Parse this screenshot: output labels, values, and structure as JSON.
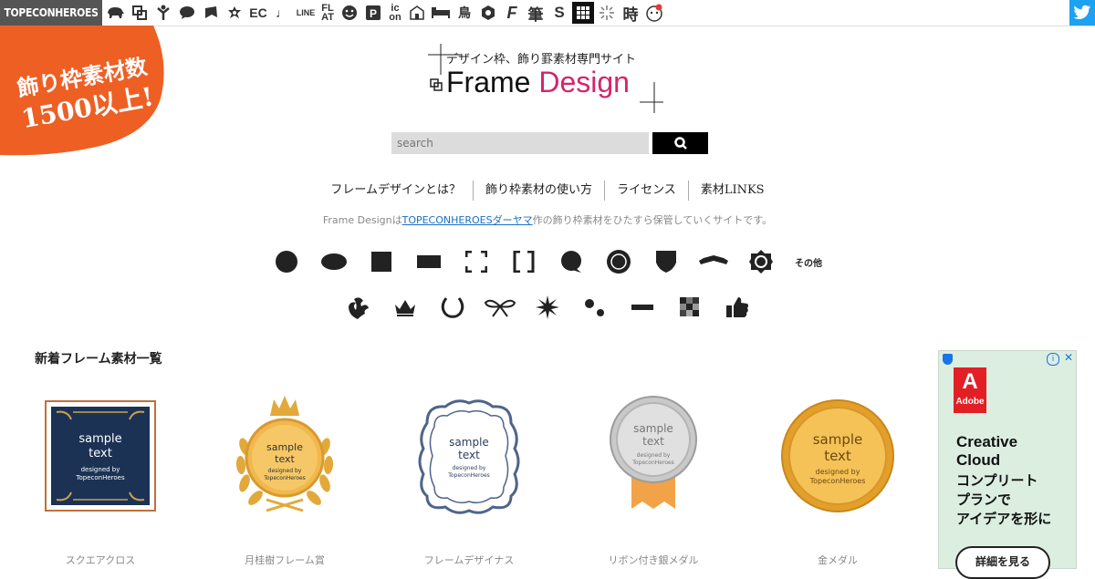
{
  "topbar": {
    "brand": "TOPECONHEROES",
    "icons": [
      {
        "name": "animal-icon",
        "glyph": "🐘"
      },
      {
        "name": "frame-icon",
        "glyph": "⧉"
      },
      {
        "name": "person-icon",
        "glyph": "Y"
      },
      {
        "name": "speech-bubble-icon",
        "glyph": "💬"
      },
      {
        "name": "cursor-icon",
        "glyph": "◣"
      },
      {
        "name": "flower-icon",
        "glyph": "✿"
      },
      {
        "name": "ec-text-icon",
        "glyph": "EC"
      },
      {
        "name": "music-note-icon",
        "glyph": "♩"
      },
      {
        "name": "line-text-icon",
        "glyph": "LINE"
      },
      {
        "name": "flat-text-icon",
        "glyph": "FL AT"
      },
      {
        "name": "smiley-icon",
        "glyph": "☻"
      },
      {
        "name": "parking-icon",
        "glyph": "P"
      },
      {
        "name": "icon-text-icon",
        "glyph": "ic on"
      },
      {
        "name": "building-icon",
        "glyph": "⌂"
      },
      {
        "name": "bed-icon",
        "glyph": "▬"
      },
      {
        "name": "bird-kanji-icon",
        "glyph": "鳥"
      },
      {
        "name": "octagon-icon",
        "glyph": "⬢"
      },
      {
        "name": "f-letter-icon",
        "glyph": "F"
      },
      {
        "name": "brush-kanji-icon",
        "glyph": "筆"
      },
      {
        "name": "s-letter-icon",
        "glyph": "S"
      },
      {
        "name": "grid-icon",
        "glyph": "▦"
      },
      {
        "name": "sparkle-icon",
        "glyph": "✳"
      },
      {
        "name": "time-kanji-icon",
        "glyph": "時"
      },
      {
        "name": "face-icon",
        "glyph": "☺"
      }
    ]
  },
  "badge": {
    "line1": "飾り枠素材数",
    "line2": "1500以上!"
  },
  "logo": {
    "subtitle": "デザイン枠、飾り罫素材専門サイト",
    "title_part1": "Frame",
    "title_part2": "Design",
    "accent": "#d4256c"
  },
  "search": {
    "placeholder": "search"
  },
  "nav": [
    {
      "label": "フレームデザインとは？"
    },
    {
      "label": "飾り枠素材の使い方"
    },
    {
      "label": "ライセンス"
    },
    {
      "label": "素材LINKS"
    }
  ],
  "tagline": {
    "before": "Frame Designは",
    "link": "TOPECONHEROESダーヤマ",
    "after": "作の飾り枠素材をひたすら保管していくサイトです。"
  },
  "categories_row1": [
    {
      "name": "circle-icon"
    },
    {
      "name": "oval-icon"
    },
    {
      "name": "square-icon"
    },
    {
      "name": "rectangle-icon"
    },
    {
      "name": "corner-brackets-icon"
    },
    {
      "name": "square-brackets-icon"
    },
    {
      "name": "speech-bubble-icon"
    },
    {
      "name": "stamp-seal-icon"
    },
    {
      "name": "shield-icon"
    },
    {
      "name": "ribbon-banner-icon"
    },
    {
      "name": "ornament-octagon-icon"
    },
    {
      "name": "other-text-icon",
      "text": "その他"
    }
  ],
  "categories_row2": [
    {
      "name": "floral-flourish-icon"
    },
    {
      "name": "crown-icon"
    },
    {
      "name": "laurel-wreath-icon"
    },
    {
      "name": "bow-knot-icon"
    },
    {
      "name": "starburst-icon"
    },
    {
      "name": "dots-icon"
    },
    {
      "name": "line-dash-icon"
    },
    {
      "name": "mosaic-icon"
    },
    {
      "name": "thumbs-up-icon"
    }
  ],
  "section": {
    "title": "新着フレーム素材一覧"
  },
  "frames": [
    {
      "label": "スクエアクロス",
      "t1": "sample",
      "t2": "text",
      "t3": "designed by",
      "t4": "TopeconHeroes"
    },
    {
      "label": "月桂樹フレーム賞",
      "t1": "sample",
      "t2": "text",
      "t3": "designed by",
      "t4": "TopeconHeroes"
    },
    {
      "label": "フレームデザイナス",
      "t1": "sample",
      "t2": "text",
      "t3": "designed by",
      "t4": "TopeconHeroes"
    },
    {
      "label": "リボン付き銀メダル",
      "t1": "sample",
      "t2": "text",
      "t3": "designed by",
      "t4": "TopeconHeroes"
    },
    {
      "label": "金メダル",
      "t1": "sample",
      "t2": "text",
      "t3": "designed by",
      "t4": "TopeconHeroes"
    }
  ],
  "ad": {
    "brand_letter": "A",
    "brand": "Adobe",
    "title1": "Creative",
    "title2": "Cloud",
    "body1": "コンプリート",
    "body2": "プランで",
    "body3": "アイデアを形に",
    "cta": "詳細を見る",
    "info": "i",
    "close": "✕"
  },
  "colors": {
    "orange": "#ee5f24",
    "pink": "#d4256c",
    "twitter": "#1da1f2",
    "link": "#1a6fc2"
  }
}
